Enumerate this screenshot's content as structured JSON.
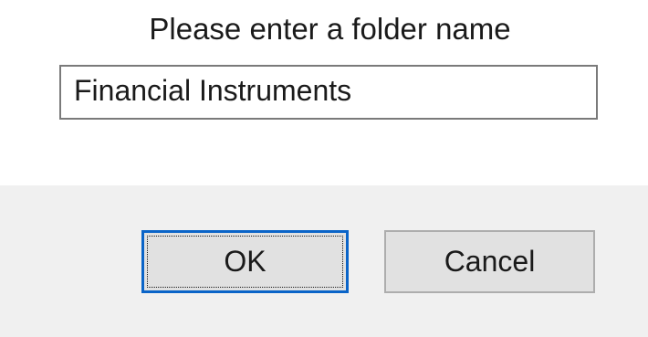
{
  "dialog": {
    "prompt": "Please enter a folder name",
    "input_value": "Financial Instruments",
    "ok_label": "OK",
    "cancel_label": "Cancel"
  },
  "colors": {
    "content_background": "#ffffff",
    "button_bar_background": "#f0f0f0",
    "button_face": "#e1e1e1",
    "default_button_border": "#0a64c8",
    "input_border": "#7a7a7a"
  }
}
